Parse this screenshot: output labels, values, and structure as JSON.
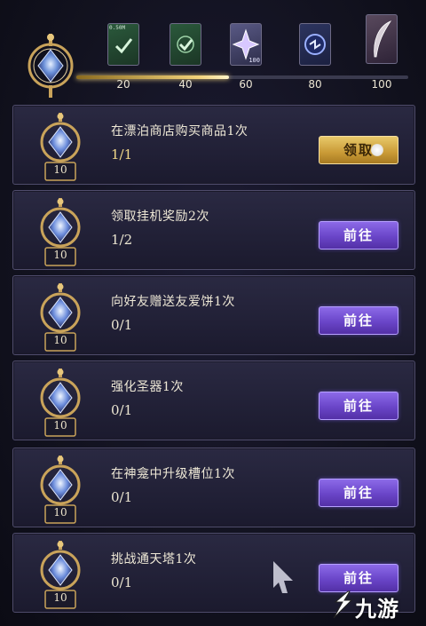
{
  "progress": {
    "fill_percent": 46,
    "milestones": [
      {
        "value": "20",
        "chest": "green-check-card",
        "label": "0.50M"
      },
      {
        "value": "40",
        "chest": "green-check-card",
        "label": ""
      },
      {
        "value": "60",
        "chest": "crystal-star-card",
        "label": "100"
      },
      {
        "value": "80",
        "chest": "blue-orb-card",
        "label": ""
      },
      {
        "value": "100",
        "chest": "feather-card",
        "label": ""
      }
    ]
  },
  "quests": [
    {
      "title": "在漂泊商店购买商品1次",
      "progress": "1/1",
      "reward": "10",
      "button": "领取",
      "state": "claim"
    },
    {
      "title": "领取挂机奖励2次",
      "progress": "1/2",
      "reward": "10",
      "button": "前往",
      "state": "go"
    },
    {
      "title": "向好友赠送友爱饼1次",
      "progress": "0/1",
      "reward": "10",
      "button": "前往",
      "state": "go"
    },
    {
      "title": "强化圣器1次",
      "progress": "0/1",
      "reward": "10",
      "button": "前往",
      "state": "go"
    },
    {
      "title": "在神龛中升级槽位1次",
      "progress": "0/1",
      "reward": "10",
      "button": "前往",
      "state": "go"
    },
    {
      "title": "挑战通天塔1次",
      "progress": "0/1",
      "reward": "10",
      "button": "前往",
      "state": "go"
    }
  ],
  "watermark": {
    "text": "九游",
    "icon": "jiuyou-logo-icon"
  },
  "colors": {
    "accent_gold": "#f2d27a",
    "button_purple": "#6a45c8",
    "button_gold": "#c99a36"
  }
}
